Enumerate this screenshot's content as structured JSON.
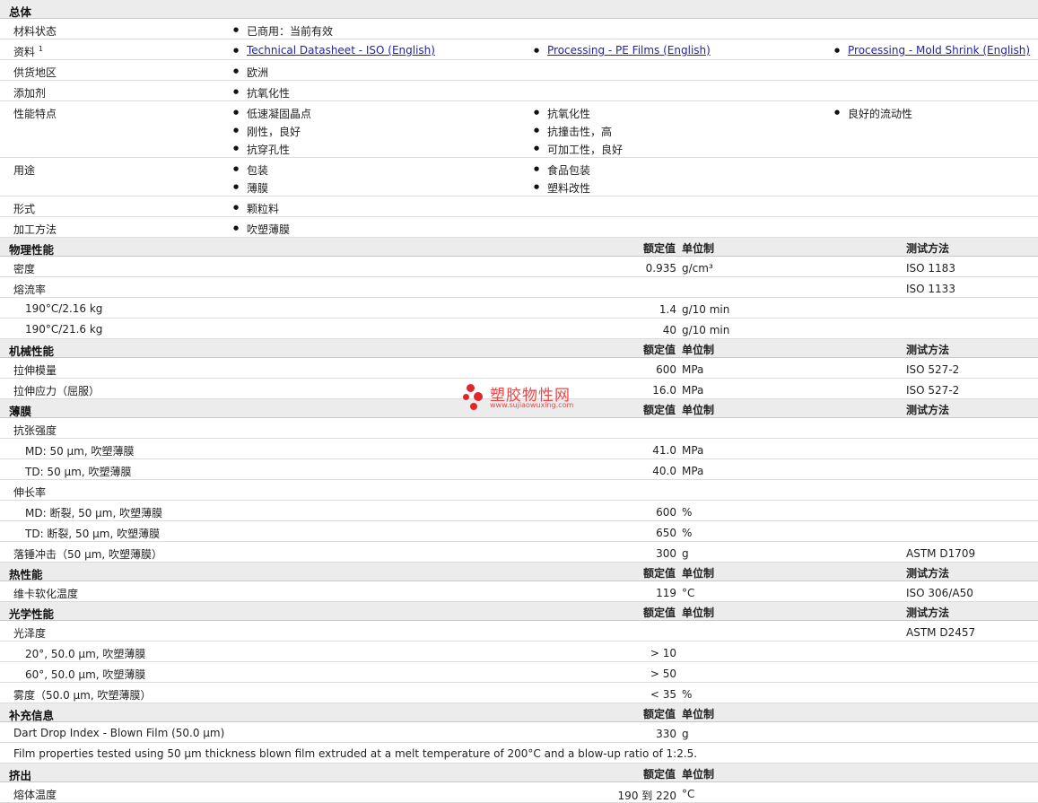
{
  "general": {
    "title": "总体",
    "rows": [
      {
        "label": "材料状态",
        "sup": "",
        "lines": [
          [
            "已商用：当前有效"
          ]
        ]
      },
      {
        "label": "资料",
        "sup": "1",
        "links": true,
        "lines": [
          [
            "Technical Datasheet - ISO (English)",
            "Processing - PE Films (English)",
            "Processing - Mold Shrink (English)"
          ]
        ]
      },
      {
        "label": "供货地区",
        "sup": "",
        "lines": [
          [
            "欧洲"
          ]
        ]
      },
      {
        "label": "添加剂",
        "sup": "",
        "lines": [
          [
            "抗氧化性"
          ]
        ]
      },
      {
        "label": "性能特点",
        "sup": "",
        "lines": [
          [
            "低速凝固晶点",
            "抗氧化性",
            "良好的流动性"
          ],
          [
            "刚性，良好",
            "抗撞击性，高"
          ],
          [
            "抗穿孔性",
            "可加工性，良好"
          ]
        ]
      },
      {
        "label": "用途",
        "sup": "",
        "lines": [
          [
            "包装",
            "食品包装"
          ],
          [
            "薄膜",
            "塑料改性"
          ]
        ]
      },
      {
        "label": "形式",
        "sup": "",
        "lines": [
          [
            "颗粒料"
          ]
        ]
      },
      {
        "label": "加工方法",
        "sup": "",
        "lines": [
          [
            "吹塑薄膜"
          ]
        ]
      }
    ]
  },
  "headers": {
    "value": "额定值",
    "unit": "单位制",
    "method": "测试方法"
  },
  "sections": [
    {
      "title": "物理性能",
      "method_header": true,
      "rows": [
        {
          "label": "密度",
          "sub": false,
          "value": "0.935",
          "unit": "g/cm³",
          "method": "ISO 1183"
        },
        {
          "label": "熔流率",
          "sub": false,
          "value": "",
          "unit": "",
          "method": "ISO 1133"
        },
        {
          "label": "190°C/2.16 kg",
          "sub": true,
          "value": "1.4",
          "unit": "g/10 min",
          "method": ""
        },
        {
          "label": "190°C/21.6 kg",
          "sub": true,
          "value": "40",
          "unit": "g/10 min",
          "method": ""
        }
      ]
    },
    {
      "title": "机械性能",
      "method_header": true,
      "rows": [
        {
          "label": "拉伸模量",
          "sub": false,
          "value": "600",
          "unit": "MPa",
          "method": "ISO 527-2"
        },
        {
          "label": "拉伸应力（屈服）",
          "sub": false,
          "value": "16.0",
          "unit": "MPa",
          "method": "ISO 527-2"
        }
      ]
    },
    {
      "title": "薄膜",
      "method_header": true,
      "rows": [
        {
          "label": "抗张强度",
          "sub": false,
          "value": "",
          "unit": "",
          "method": ""
        },
        {
          "label": "MD: 50 µm, 吹塑薄膜",
          "sub": true,
          "value": "41.0",
          "unit": "MPa",
          "method": ""
        },
        {
          "label": "TD: 50 µm, 吹塑薄膜",
          "sub": true,
          "value": "40.0",
          "unit": "MPa",
          "method": ""
        },
        {
          "label": "伸长率",
          "sub": false,
          "value": "",
          "unit": "",
          "method": ""
        },
        {
          "label": "MD: 断裂, 50 µm, 吹塑薄膜",
          "sub": true,
          "value": "600",
          "unit": "%",
          "method": ""
        },
        {
          "label": "TD: 断裂, 50 µm, 吹塑薄膜",
          "sub": true,
          "value": "650",
          "unit": "%",
          "method": ""
        },
        {
          "label": "落锤冲击（50 µm, 吹塑薄膜）",
          "sub": false,
          "value": "300",
          "unit": "g",
          "method": "ASTM D1709"
        }
      ]
    },
    {
      "title": "热性能",
      "method_header": true,
      "rows": [
        {
          "label": "维卡软化温度",
          "sub": false,
          "value": "119",
          "unit": "°C",
          "method": "ISO 306/A50"
        }
      ]
    },
    {
      "title": "光学性能",
      "method_header": true,
      "rows": [
        {
          "label": "光泽度",
          "sub": false,
          "value": "",
          "unit": "",
          "method": "ASTM D2457"
        },
        {
          "label": "20°, 50.0 µm, 吹塑薄膜",
          "sub": true,
          "value": "> 10",
          "unit": "",
          "method": ""
        },
        {
          "label": "60°, 50.0 µm, 吹塑薄膜",
          "sub": true,
          "value": "> 50",
          "unit": "",
          "method": ""
        },
        {
          "label": "雾度（50.0 µm, 吹塑薄膜）",
          "sub": false,
          "value": "< 35",
          "unit": "%",
          "method": ""
        }
      ]
    },
    {
      "title": "补充信息",
      "method_header": false,
      "rows": [
        {
          "label": "Dart Drop Index - Blown Film (50.0 µm)",
          "sub": false,
          "value": "330",
          "unit": "g",
          "method": ""
        },
        {
          "label": "Film properties tested using 50 µm thickness blown film extruded at a melt temperature of 200°C and a blow-up ratio of 1:2.5.",
          "sub": false,
          "value": "",
          "unit": "",
          "method": "",
          "note": true
        }
      ]
    },
    {
      "title": "挤出",
      "method_header": false,
      "rows": [
        {
          "label": "熔体温度",
          "sub": false,
          "value": "190 到  220",
          "unit": "°C",
          "method": ""
        }
      ]
    }
  ],
  "watermark": {
    "cn": "塑胶物性网",
    "en": "www.sujiaowuxing.com",
    "color": "#e0262b"
  }
}
